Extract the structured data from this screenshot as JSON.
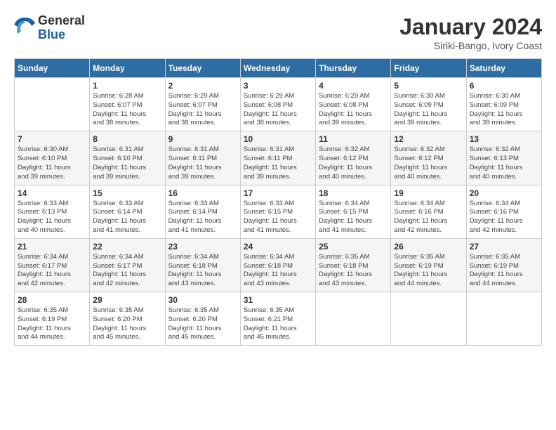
{
  "header": {
    "logo_line1": "General",
    "logo_line2": "Blue",
    "month": "January 2024",
    "location": "Siriki-Bango, Ivory Coast"
  },
  "weekdays": [
    "Sunday",
    "Monday",
    "Tuesday",
    "Wednesday",
    "Thursday",
    "Friday",
    "Saturday"
  ],
  "weeks": [
    [
      {
        "num": "",
        "content": ""
      },
      {
        "num": "1",
        "content": "Sunrise: 6:28 AM\nSunset: 6:07 PM\nDaylight: 11 hours\nand 38 minutes."
      },
      {
        "num": "2",
        "content": "Sunrise: 6:29 AM\nSunset: 6:07 PM\nDaylight: 11 hours\nand 38 minutes."
      },
      {
        "num": "3",
        "content": "Sunrise: 6:29 AM\nSunset: 6:08 PM\nDaylight: 11 hours\nand 38 minutes."
      },
      {
        "num": "4",
        "content": "Sunrise: 6:29 AM\nSunset: 6:08 PM\nDaylight: 11 hours\nand 39 minutes."
      },
      {
        "num": "5",
        "content": "Sunrise: 6:30 AM\nSunset: 6:09 PM\nDaylight: 11 hours\nand 39 minutes."
      },
      {
        "num": "6",
        "content": "Sunrise: 6:30 AM\nSunset: 6:09 PM\nDaylight: 11 hours\nand 39 minutes."
      }
    ],
    [
      {
        "num": "7",
        "content": "Sunrise: 6:30 AM\nSunset: 6:10 PM\nDaylight: 11 hours\nand 39 minutes."
      },
      {
        "num": "8",
        "content": "Sunrise: 6:31 AM\nSunset: 6:10 PM\nDaylight: 11 hours\nand 39 minutes."
      },
      {
        "num": "9",
        "content": "Sunrise: 6:31 AM\nSunset: 6:11 PM\nDaylight: 11 hours\nand 39 minutes."
      },
      {
        "num": "10",
        "content": "Sunrise: 6:31 AM\nSunset: 6:11 PM\nDaylight: 11 hours\nand 39 minutes."
      },
      {
        "num": "11",
        "content": "Sunrise: 6:32 AM\nSunset: 6:12 PM\nDaylight: 11 hours\nand 40 minutes."
      },
      {
        "num": "12",
        "content": "Sunrise: 6:32 AM\nSunset: 6:12 PM\nDaylight: 11 hours\nand 40 minutes."
      },
      {
        "num": "13",
        "content": "Sunrise: 6:32 AM\nSunset: 6:13 PM\nDaylight: 11 hours\nand 40 minutes."
      }
    ],
    [
      {
        "num": "14",
        "content": "Sunrise: 6:33 AM\nSunset: 6:13 PM\nDaylight: 11 hours\nand 40 minutes."
      },
      {
        "num": "15",
        "content": "Sunrise: 6:33 AM\nSunset: 6:14 PM\nDaylight: 11 hours\nand 41 minutes."
      },
      {
        "num": "16",
        "content": "Sunrise: 6:33 AM\nSunset: 6:14 PM\nDaylight: 11 hours\nand 41 minutes."
      },
      {
        "num": "17",
        "content": "Sunrise: 6:33 AM\nSunset: 6:15 PM\nDaylight: 11 hours\nand 41 minutes."
      },
      {
        "num": "18",
        "content": "Sunrise: 6:34 AM\nSunset: 6:15 PM\nDaylight: 11 hours\nand 41 minutes."
      },
      {
        "num": "19",
        "content": "Sunrise: 6:34 AM\nSunset: 6:16 PM\nDaylight: 11 hours\nand 42 minutes."
      },
      {
        "num": "20",
        "content": "Sunrise: 6:34 AM\nSunset: 6:16 PM\nDaylight: 11 hours\nand 42 minutes."
      }
    ],
    [
      {
        "num": "21",
        "content": "Sunrise: 6:34 AM\nSunset: 6:17 PM\nDaylight: 11 hours\nand 42 minutes."
      },
      {
        "num": "22",
        "content": "Sunrise: 6:34 AM\nSunset: 6:17 PM\nDaylight: 11 hours\nand 42 minutes."
      },
      {
        "num": "23",
        "content": "Sunrise: 6:34 AM\nSunset: 6:18 PM\nDaylight: 11 hours\nand 43 minutes."
      },
      {
        "num": "24",
        "content": "Sunrise: 6:34 AM\nSunset: 6:18 PM\nDaylight: 11 hours\nand 43 minutes."
      },
      {
        "num": "25",
        "content": "Sunrise: 6:35 AM\nSunset: 6:18 PM\nDaylight: 11 hours\nand 43 minutes."
      },
      {
        "num": "26",
        "content": "Sunrise: 6:35 AM\nSunset: 6:19 PM\nDaylight: 11 hours\nand 44 minutes."
      },
      {
        "num": "27",
        "content": "Sunrise: 6:35 AM\nSunset: 6:19 PM\nDaylight: 11 hours\nand 44 minutes."
      }
    ],
    [
      {
        "num": "28",
        "content": "Sunrise: 6:35 AM\nSunset: 6:19 PM\nDaylight: 11 hours\nand 44 minutes."
      },
      {
        "num": "29",
        "content": "Sunrise: 6:35 AM\nSunset: 6:20 PM\nDaylight: 11 hours\nand 45 minutes."
      },
      {
        "num": "30",
        "content": "Sunrise: 6:35 AM\nSunset: 6:20 PM\nDaylight: 11 hours\nand 45 minutes."
      },
      {
        "num": "31",
        "content": "Sunrise: 6:35 AM\nSunset: 6:21 PM\nDaylight: 11 hours\nand 45 minutes."
      },
      {
        "num": "",
        "content": ""
      },
      {
        "num": "",
        "content": ""
      },
      {
        "num": "",
        "content": ""
      }
    ]
  ]
}
